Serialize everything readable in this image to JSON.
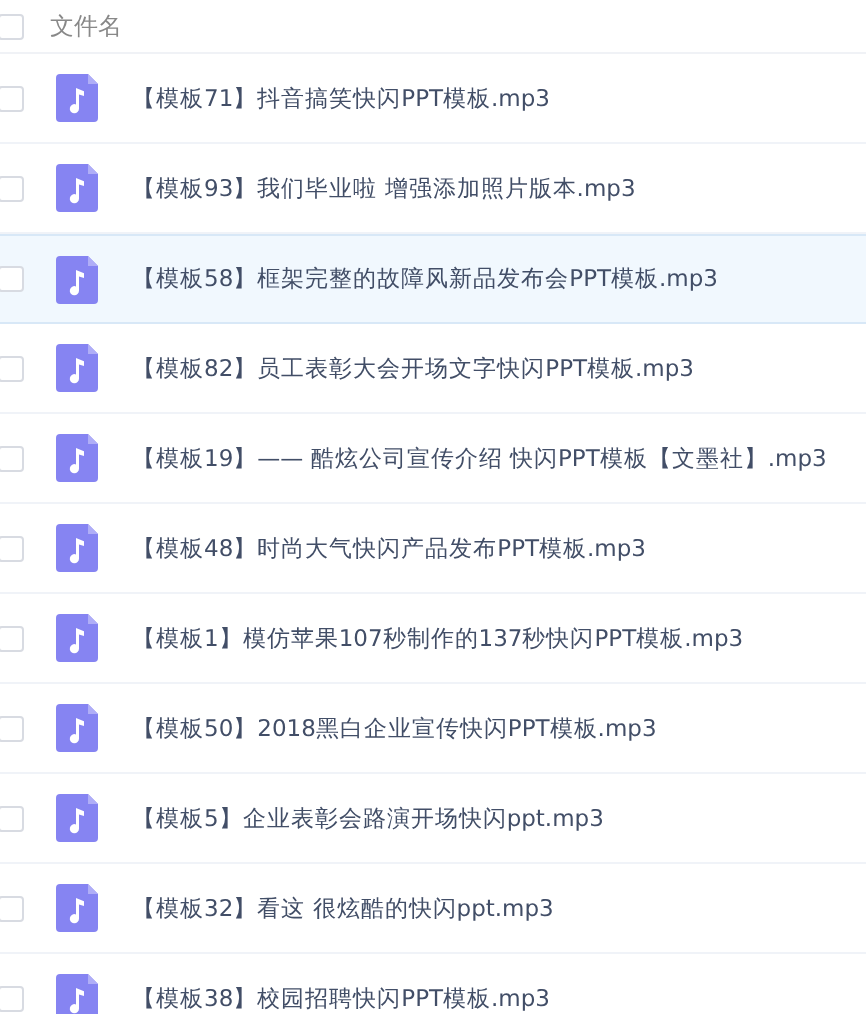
{
  "header": {
    "label": "文件名",
    "checked": false
  },
  "files": [
    {
      "name": "【模板71】抖音搞笑快闪PPT模板.mp3",
      "checked": false,
      "highlighted": false
    },
    {
      "name": "【模板93】我们毕业啦 增强添加照片版本.mp3",
      "checked": false,
      "highlighted": false
    },
    {
      "name": "【模板58】框架完整的故障风新品发布会PPT模板.mp3",
      "checked": false,
      "highlighted": true
    },
    {
      "name": "【模板82】员工表彰大会开场文字快闪PPT模板.mp3",
      "checked": false,
      "highlighted": false
    },
    {
      "name": "【模板19】—— 酷炫公司宣传介绍 快闪PPT模板【文墨社】.mp3",
      "checked": false,
      "highlighted": false
    },
    {
      "name": "【模板48】时尚大气快闪产品发布PPT模板.mp3",
      "checked": false,
      "highlighted": false
    },
    {
      "name": "【模板1】模仿苹果107秒制作的137秒快闪PPT模板.mp3",
      "checked": false,
      "highlighted": false
    },
    {
      "name": "【模板50】2018黑白企业宣传快闪PPT模板.mp3",
      "checked": false,
      "highlighted": false
    },
    {
      "name": "【模板5】企业表彰会路演开场快闪ppt.mp3",
      "checked": false,
      "highlighted": false
    },
    {
      "name": "【模板32】看这 很炫酷的快闪ppt.mp3",
      "checked": false,
      "highlighted": false
    },
    {
      "name": "【模板38】校园招聘快闪PPT模板.mp3",
      "checked": false,
      "highlighted": false
    }
  ]
}
